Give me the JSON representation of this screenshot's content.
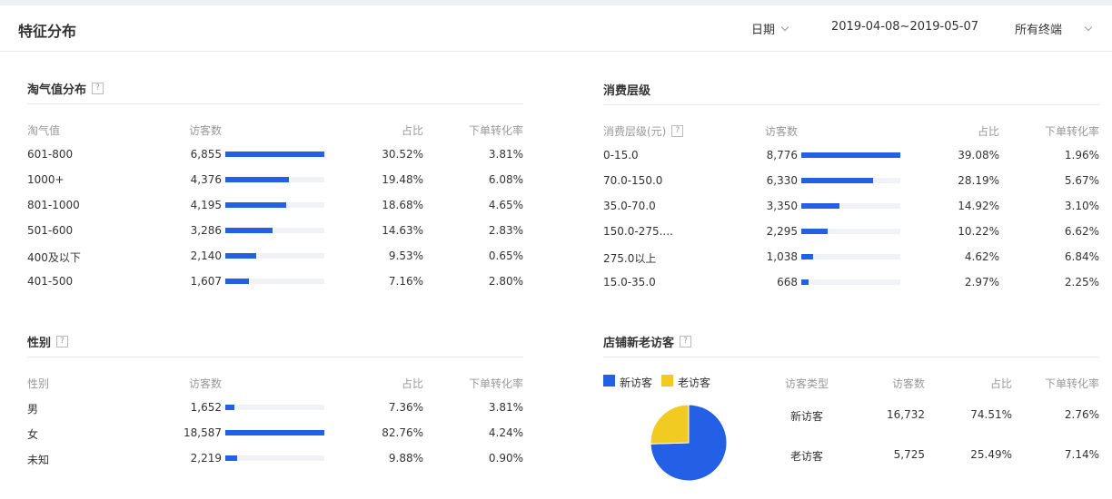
{
  "header": {
    "title": "特征分布",
    "date_label": "日期",
    "date_range": "2019-04-08~2019-05-07",
    "terminal": "所有终端"
  },
  "help_glyph": "?",
  "taoqi": {
    "title": "淘气值分布",
    "columns": [
      "淘气值",
      "访客数",
      "占比",
      "下单转化率"
    ],
    "rows": [
      {
        "label": "601-800",
        "visitors": "6,855",
        "share": "30.52%",
        "conv": "3.81%",
        "ratio": 1.0
      },
      {
        "label": "1000+",
        "visitors": "4,376",
        "share": "19.48%",
        "conv": "6.08%",
        "ratio": 0.638
      },
      {
        "label": "801-1000",
        "visitors": "4,195",
        "share": "18.68%",
        "conv": "4.65%",
        "ratio": 0.612
      },
      {
        "label": "501-600",
        "visitors": "3,286",
        "share": "14.63%",
        "conv": "2.83%",
        "ratio": 0.479
      },
      {
        "label": "400及以下",
        "visitors": "2,140",
        "share": "9.53%",
        "conv": "0.65%",
        "ratio": 0.312
      },
      {
        "label": "401-500",
        "visitors": "1,607",
        "share": "7.16%",
        "conv": "2.80%",
        "ratio": 0.234
      }
    ]
  },
  "spend": {
    "title": "消费层级",
    "columns": [
      "消费层级(元)",
      "访客数",
      "占比",
      "下单转化率"
    ],
    "rows": [
      {
        "label": "0-15.0",
        "visitors": "8,776",
        "share": "39.08%",
        "conv": "1.96%",
        "ratio": 1.0
      },
      {
        "label": "70.0-150.0",
        "visitors": "6,330",
        "share": "28.19%",
        "conv": "5.67%",
        "ratio": 0.721
      },
      {
        "label": "35.0-70.0",
        "visitors": "3,350",
        "share": "14.92%",
        "conv": "3.10%",
        "ratio": 0.382
      },
      {
        "label": "150.0-275....",
        "visitors": "2,295",
        "share": "10.22%",
        "conv": "6.62%",
        "ratio": 0.262
      },
      {
        "label": "275.0以上",
        "visitors": "1,038",
        "share": "4.62%",
        "conv": "6.84%",
        "ratio": 0.118
      },
      {
        "label": "15.0-35.0",
        "visitors": "668",
        "share": "2.97%",
        "conv": "2.25%",
        "ratio": 0.076
      }
    ]
  },
  "gender": {
    "title": "性别",
    "columns": [
      "性别",
      "访客数",
      "占比",
      "下单转化率"
    ],
    "rows": [
      {
        "label": "男",
        "visitors": "1,652",
        "share": "7.36%",
        "conv": "3.81%",
        "ratio": 0.089
      },
      {
        "label": "女",
        "visitors": "18,587",
        "share": "82.76%",
        "conv": "4.24%",
        "ratio": 1.0
      },
      {
        "label": "未知",
        "visitors": "2,219",
        "share": "9.88%",
        "conv": "0.90%",
        "ratio": 0.119
      }
    ]
  },
  "newold": {
    "title": "店铺新老访客",
    "legend": [
      {
        "name": "新访客",
        "color": "#2460e6"
      },
      {
        "name": "老访客",
        "color": "#f2cb22"
      }
    ],
    "columns": [
      "访客类型",
      "访客数",
      "占比",
      "下单转化率"
    ],
    "rows": [
      {
        "label": "新访客",
        "visitors": "16,732",
        "share": "74.51%",
        "conv": "2.76%"
      },
      {
        "label": "老访客",
        "visitors": "5,725",
        "share": "25.49%",
        "conv": "7.14%"
      }
    ]
  },
  "chart_data": {
    "type": "pie",
    "categories": [
      "新访客",
      "老访客"
    ],
    "values": [
      74.51,
      25.49
    ],
    "colors": [
      "#2460e6",
      "#f2cb22"
    ]
  }
}
